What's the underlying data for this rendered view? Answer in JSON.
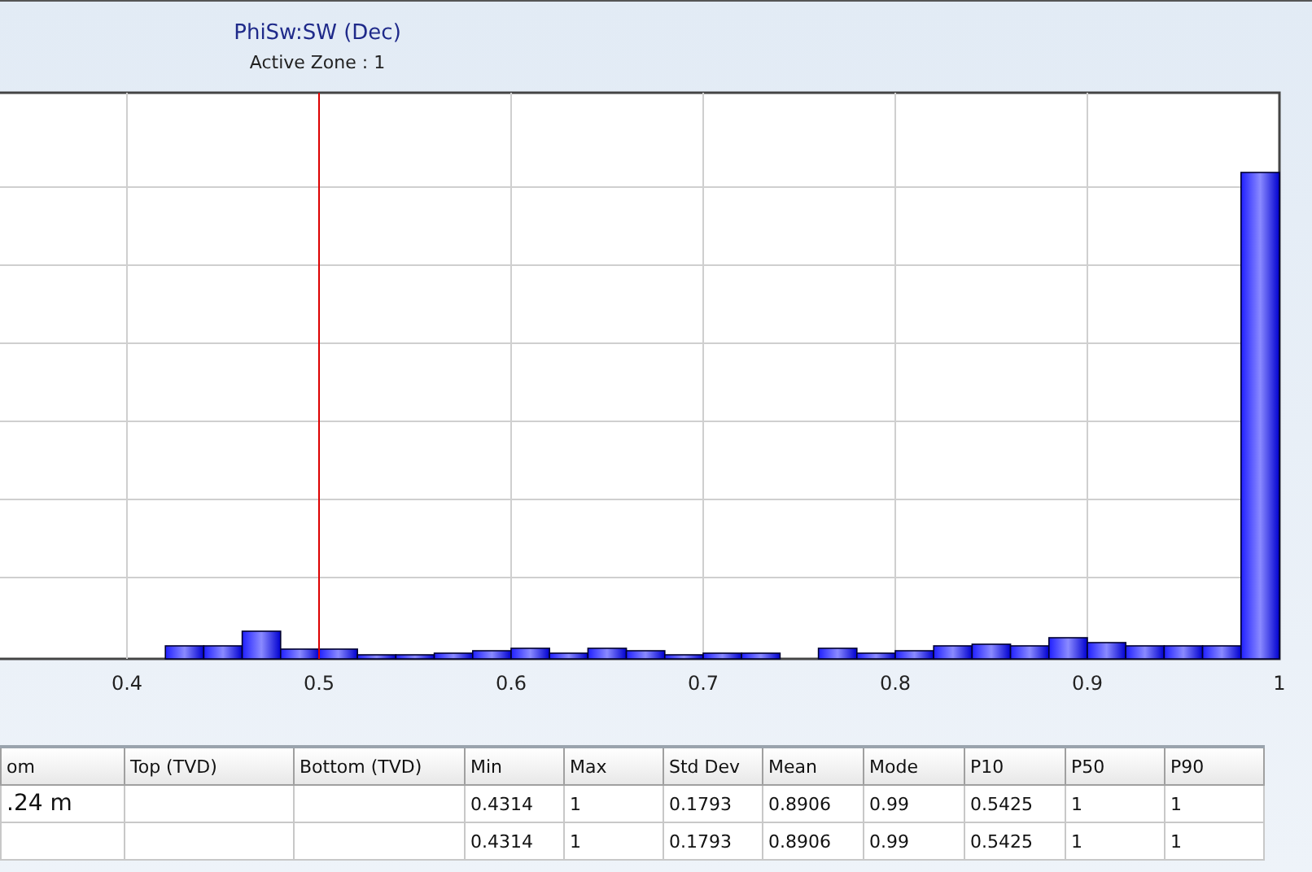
{
  "chart": {
    "title": "PhiSw:SW (Dec)",
    "subtitle": "Active Zone : 1",
    "x_tick_labels": [
      "0.4",
      "0.5",
      "0.6",
      "0.7",
      "0.8",
      "0.9",
      "1"
    ]
  },
  "table": {
    "columns": [
      "om",
      "Top (TVD)",
      "Bottom (TVD)",
      "Min",
      "Max",
      "Std Dev",
      "Mean",
      "Mode",
      "P10",
      "P50",
      "P90"
    ],
    "rows": [
      {
        "cells": [
          ".24 m",
          "",
          "",
          "0.4314",
          "1",
          "0.1793",
          "0.8906",
          "0.99",
          "0.5425",
          "1",
          "1"
        ]
      },
      {
        "cells": [
          "",
          "",
          "",
          "0.4314",
          "1",
          "0.1793",
          "0.8906",
          "0.99",
          "0.5425",
          "1",
          "1"
        ]
      }
    ]
  }
}
